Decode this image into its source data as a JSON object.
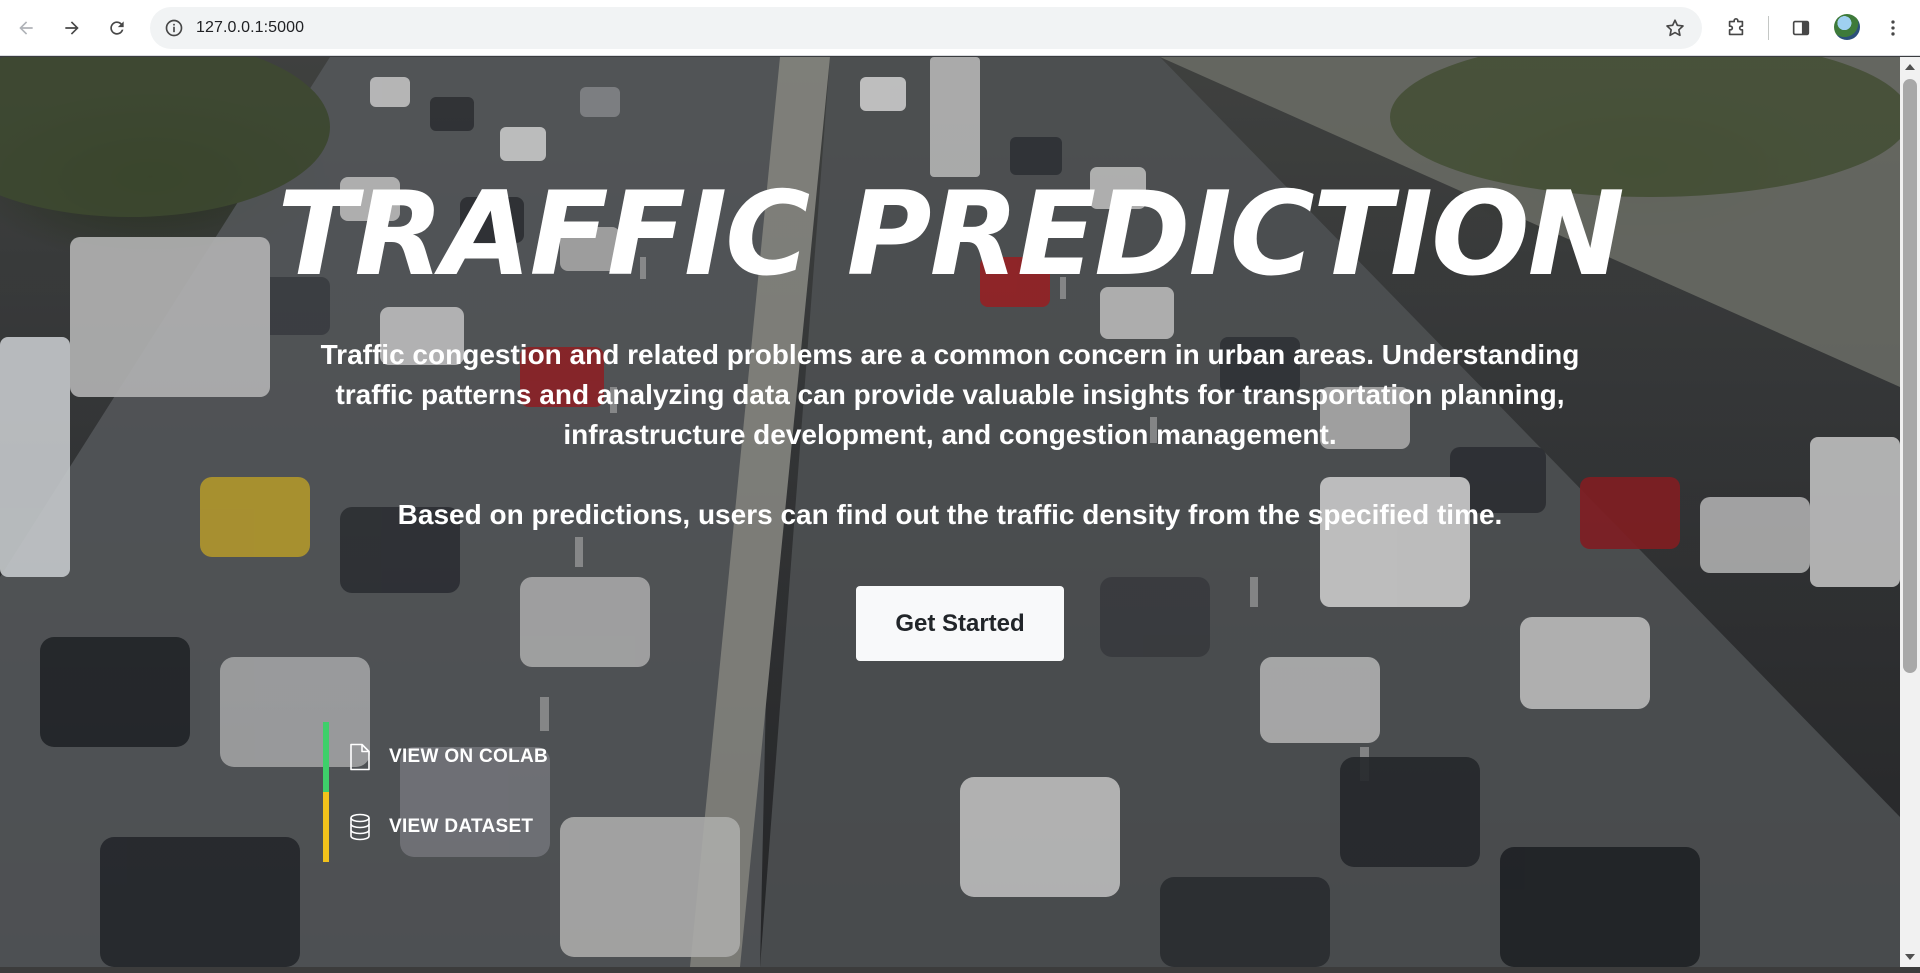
{
  "browser": {
    "url": "127.0.0.1:5000",
    "icons": {
      "back": "arrow-left-icon",
      "forward": "arrow-right-icon",
      "reload": "reload-icon",
      "site_info": "info-icon",
      "bookmark": "star-icon",
      "extensions": "puzzle-icon",
      "side_panel": "side-panel-icon",
      "profile": "avatar",
      "menu": "kebab-menu-icon"
    }
  },
  "hero": {
    "title": "TRAFFIC PREDICTION",
    "description": "Traffic congestion and related problems are a common concern in urban areas. Understanding traffic patterns and analyzing data can provide valuable insights for transportation planning, infrastructure development, and congestion management.",
    "subtext": "Based on predictions, users can find out the traffic density from the specified time.",
    "cta_label": "Get Started",
    "links": [
      {
        "label": "VIEW ON COLAB",
        "icon": "file-icon",
        "accent": "#3ecf6a"
      },
      {
        "label": "VIEW DATASET",
        "icon": "database-icon",
        "accent": "#f2c21b"
      }
    ]
  }
}
